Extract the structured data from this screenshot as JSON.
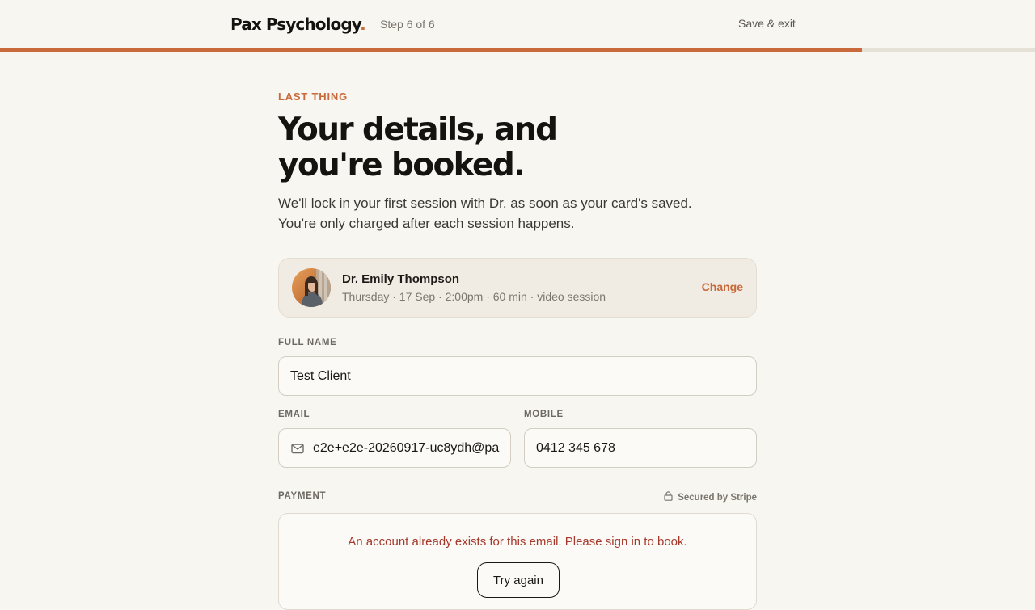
{
  "header": {
    "brand": "Pax Psychology",
    "brand_dot": ".",
    "step": "Step 6 of 6",
    "save_exit": "Save & exit",
    "progress_percent": 83.3
  },
  "intro": {
    "eyebrow": "LAST THING",
    "title": "Your details, and you're booked.",
    "subtitle_line1": "We'll lock in your first session with Dr. as soon as your card's saved.",
    "subtitle_line2": "You're only charged after each session happens."
  },
  "therapist": {
    "name": "Dr. Emily Thompson",
    "meta": "Thursday · 17 Sep · 2:00pm · 60 min · video session",
    "change_label": "Change"
  },
  "form": {
    "full_name_label": "FULL NAME",
    "full_name_value": "Test Client",
    "email_label": "EMAIL",
    "email_value": "e2e+e2e-20260917-uc8ydh@pa",
    "mobile_label": "MOBILE",
    "mobile_value": "0412 345 678"
  },
  "payment": {
    "label": "PAYMENT",
    "secured": "Secured by Stripe",
    "error": "An account already exists for this email. Please sign in to book.",
    "try_again": "Try again"
  },
  "icons": {
    "email": "mail-icon",
    "lock": "lock-icon"
  },
  "colors": {
    "accent": "#c96a3c",
    "background": "#f8f6f1",
    "error": "#a5382b"
  }
}
